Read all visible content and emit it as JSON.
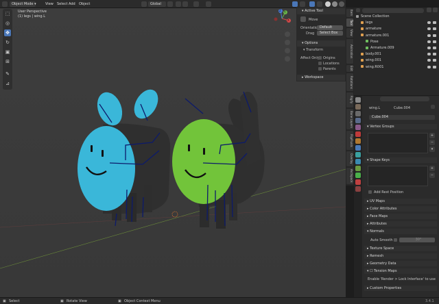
{
  "header": {
    "mode": "Object Mode",
    "menu": [
      "View",
      "Select",
      "Add",
      "Object"
    ],
    "orientation": "Global"
  },
  "viewport": {
    "title": "User Perspective",
    "subtitle": "(1) legs | wing.L",
    "axis_x": "X",
    "axis_y": "Y",
    "axis_z": "Z"
  },
  "npanel": {
    "active_tool_title": "Active Tool",
    "tool_name": "Move",
    "orientation_label": "Orientation",
    "orientation_value": "Default",
    "drag_label": "Drag",
    "drag_value": "Select Box",
    "options_title": "Options",
    "transform_title": "Transform",
    "affect_only": "Affect Only",
    "origins": "Origins",
    "locations": "Locations",
    "parents": "Parents",
    "workspace_title": "Workspace"
  },
  "sidebar_tabs": [
    "Item",
    "Tool",
    "View",
    "Animation",
    "Edit",
    "Rotations",
    "Rigify",
    "Bone Layers",
    "FlipFluids",
    "Overlay",
    "Archipack"
  ],
  "outliner": {
    "rows": [
      {
        "label": "Scene Collection",
        "color": "#9a9a9a",
        "indent": 0
      },
      {
        "label": "legs",
        "color": "#e0a050",
        "indent": 1
      },
      {
        "label": "armature",
        "color": "#e0a050",
        "indent": 1
      },
      {
        "label": "armature.001",
        "color": "#e0a050",
        "indent": 1
      },
      {
        "label": "Pose",
        "color": "#6fbf60",
        "indent": 2
      },
      {
        "label": "Armature.009",
        "color": "#6fbf60",
        "indent": 2
      },
      {
        "label": "body.001",
        "color": "#e0a050",
        "indent": 1
      },
      {
        "label": "wing.001",
        "color": "#e0a050",
        "indent": 1
      },
      {
        "label": "wing.R001",
        "color": "#e0a050",
        "indent": 1
      }
    ]
  },
  "properties": {
    "object_name": "wing.L",
    "mesh_data": "Cube.004",
    "mesh_field": "Cube.004",
    "vertex_groups": "Vertex Groups",
    "shape_keys": "Shape Keys",
    "add_rest_position": "Add Rest Position",
    "sections": [
      "UV Maps",
      "Color Attributes",
      "Face Maps",
      "Attributes",
      "Normals"
    ],
    "auto_smooth": "Auto Smooth",
    "auto_smooth_angle": "30°",
    "sections2": [
      "Texture Space",
      "Remesh",
      "Geometry Data"
    ],
    "tension_maps": "Tension Maps",
    "tension_note": "Enable 'Render > Lock Interface' to use",
    "custom_properties": "Custom Properties"
  },
  "status": {
    "select": "Select",
    "rotate": "Rotate View",
    "context": "Object Context Menu",
    "version": "3.4.1"
  },
  "colors": {
    "blue_creature": "#3ab7d9",
    "green_creature": "#72c43a",
    "body_dark": "#303030",
    "bone": "#0c1a6b",
    "accent": "#4a77b8"
  }
}
